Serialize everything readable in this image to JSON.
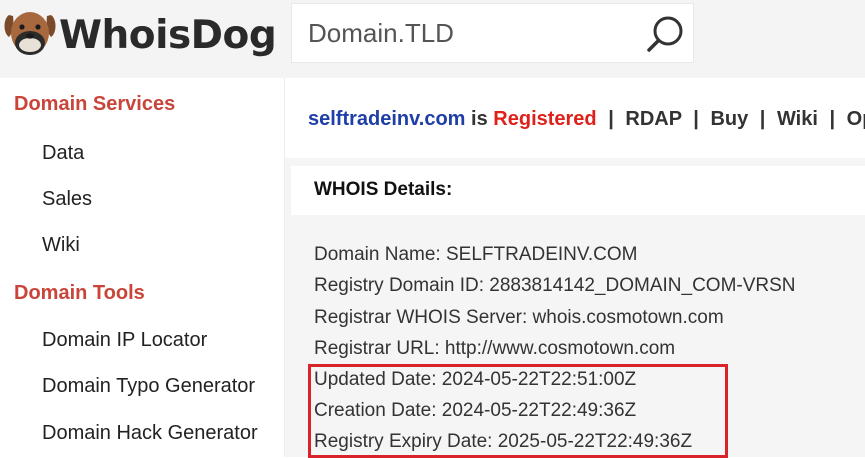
{
  "header": {
    "logo_text": "WhoisDog",
    "search_placeholder": "Domain.TLD"
  },
  "sidebar": {
    "sections": [
      {
        "title": "Domain Services",
        "items": [
          "Data",
          "Sales",
          "Wiki"
        ]
      },
      {
        "title": "Domain Tools",
        "items": [
          "Domain IP Locator",
          "Domain Typo Generator",
          "Domain Hack Generator"
        ]
      }
    ]
  },
  "status": {
    "domain": "selftradeinv.com",
    "is_text": "is",
    "state": "Registered",
    "separator": "|",
    "links": [
      "RDAP",
      "Buy",
      "Wiki",
      "Open"
    ]
  },
  "details": {
    "title": "WHOIS Details:",
    "lines": [
      "Domain Name: SELFTRADEINV.COM",
      "Registry Domain ID: 2883814142_DOMAIN_COM-VRSN",
      "Registrar WHOIS Server: whois.cosmotown.com",
      "Registrar URL: http://www.cosmotown.com",
      "Updated Date: 2024-05-22T22:51:00Z",
      "Creation Date: 2024-05-22T22:49:36Z",
      "Registry Expiry Date: 2025-05-22T22:49:36Z"
    ]
  },
  "colors": {
    "section_heading": "#c9453a",
    "domain_link": "#1f3fa8",
    "registered": "#e0201b",
    "highlight_border": "#d8232a"
  }
}
